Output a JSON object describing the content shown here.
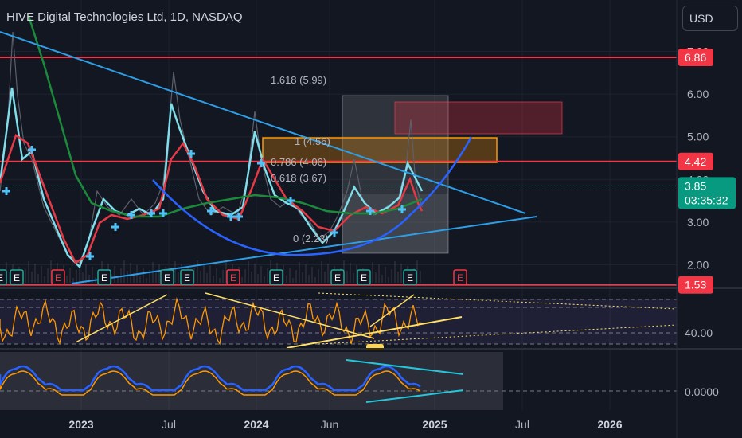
{
  "header": {
    "title": "HIVE Digital Technologies Ltd, 1D, NASDAQ",
    "currency_button": "USD"
  },
  "colors": {
    "background": "#131722",
    "grid": "#1e222d",
    "axis_text": "#b2b5be",
    "price_line_red": "#f23645",
    "price_red_dark": "#c9242f",
    "trend_blue": "#2d9fe8",
    "curve_blue": "#2962ff",
    "cyan_ma": "#80deea",
    "red_ma": "#e53945",
    "green_ma": "#1b8a3a",
    "orange_osc": "#ff9800",
    "yellow_line": "#ffe066",
    "current_price_badge": "#089981",
    "earnings_marker": "#f23645"
  },
  "chart_data": {
    "type": "line",
    "x_tick_labels": [
      "2023",
      "Jul",
      "2024",
      "Jun",
      "2025",
      "Jul",
      "2026"
    ],
    "price_axis_labels": [
      "7.00",
      "6.00",
      "5.00",
      "4.00",
      "3.00",
      "2.00"
    ],
    "price_badges": [
      {
        "value": "6.86",
        "color": "#f23645"
      },
      {
        "value": "4.42",
        "color": "#f23645"
      },
      {
        "value": "1.53",
        "color": "#f23645"
      }
    ],
    "current_price": {
      "value": "3.85",
      "countdown": "03:35:32"
    },
    "fib_labels": [
      "1.618 (5.99)",
      "1 (4.56)",
      "0.786 (4.06)",
      "0.618 (3.67)",
      "0 (2.23)"
    ],
    "horizontal_levels": [
      6.86,
      4.42,
      1.53
    ],
    "price_series": {
      "name": "",
      "dates": [
        "2022-10-01",
        "2022-11-01",
        "2022-12-01",
        "2023-01-01",
        "2023-02-01",
        "2023-03-01",
        "2023-04-01",
        "2023-05-01",
        "2023-06-01",
        "2023-07-01",
        "2023-08-01",
        "2023-09-01",
        "2023-10-01",
        "2023-11-01",
        "2023-12-01",
        "2024-01-01",
        "2024-02-01",
        "2024-03-01",
        "2024-04-01",
        "2024-05-01",
        "2024-06-01",
        "2024-07-01",
        "2024-08-01",
        "2024-09-01",
        "2024-10-01",
        "2024-11-01",
        "2024-12-01"
      ],
      "values": [
        4.6,
        3.8,
        2.4,
        2.1,
        3.5,
        3.0,
        3.2,
        3.1,
        3.3,
        6.4,
        4.5,
        3.4,
        3.1,
        3.0,
        4.8,
        5.1,
        3.8,
        3.4,
        3.3,
        2.6,
        3.2,
        4.1,
        3.0,
        3.2,
        3.6,
        5.2,
        3.85
      ]
    },
    "earnings_markers": {
      "label": "E",
      "count": 11
    },
    "oscillator_axis_labels": [
      "40.00",
      "0.0000"
    ]
  }
}
